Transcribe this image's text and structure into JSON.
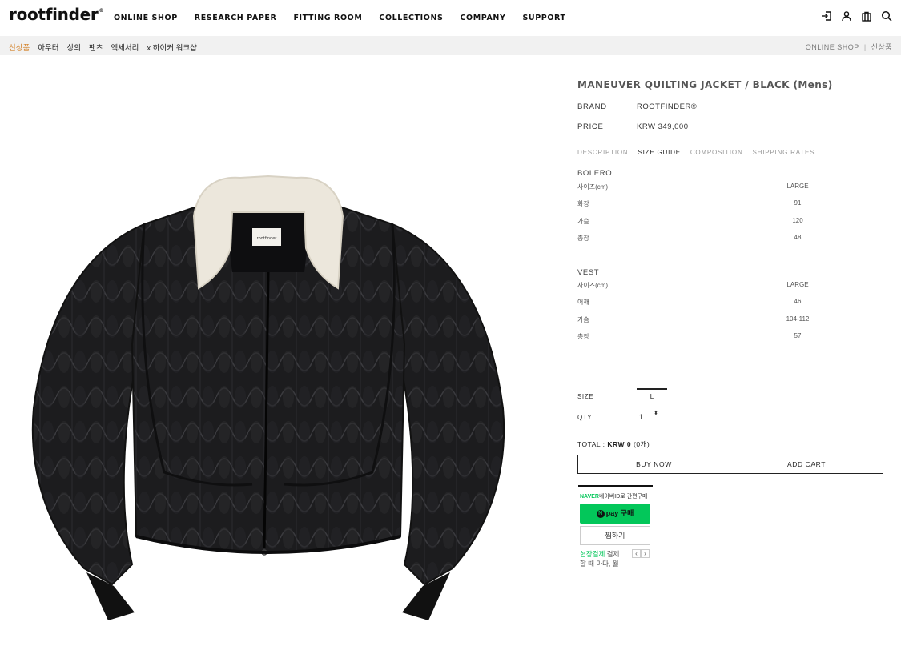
{
  "header": {
    "logo": "rootfinder",
    "logo_mark": "®",
    "nav": [
      "ONLINE SHOP",
      "RESEARCH PAPER",
      "FITTING ROOM",
      "COLLECTIONS",
      "COMPANY",
      "SUPPORT"
    ],
    "icons": [
      "login-icon",
      "user-icon",
      "shopping-bag-icon",
      "search-icon"
    ]
  },
  "subnav": {
    "categories": [
      "신상품",
      "아우터",
      "상의",
      "팬츠",
      "액세서리",
      "x 하이커 워크샵"
    ],
    "breadcrumb": [
      "ONLINE SHOP",
      "신상품"
    ],
    "breadcrumb_sep": "|"
  },
  "product": {
    "image_label": "rootfinder",
    "title": "MANEUVER QUILTING JACKET / BLACK (Mens)",
    "brand_label": "BRAND",
    "brand": "ROOTFINDER®",
    "price_label": "PRICE",
    "price": "KRW 349,000"
  },
  "tabs": [
    "DESCRIPTION",
    "SIZE GUIDE",
    "COMPOSITION",
    "SHIPPING RATES"
  ],
  "size_guide": {
    "bolero": {
      "title": "BOLERO",
      "rows": [
        {
          "k": "사이즈(cm)",
          "v": "LARGE"
        },
        {
          "k": "화장",
          "v": "91"
        },
        {
          "k": "가슴",
          "v": "120"
        },
        {
          "k": "총장",
          "v": "48"
        }
      ]
    },
    "vest": {
      "title": "VEST",
      "rows": [
        {
          "k": "사이즈(cm)",
          "v": "LARGE"
        },
        {
          "k": "어깨",
          "v": "46"
        },
        {
          "k": "가슴",
          "v": "104-112"
        },
        {
          "k": "총장",
          "v": "57"
        }
      ]
    }
  },
  "options": {
    "size_label": "SIZE",
    "size_value": "L",
    "qty_label": "QTY",
    "qty_value": "1",
    "qty_stepper": "⬍"
  },
  "total": {
    "label": "TOTAL :",
    "amount": "KRW 0",
    "count": "(0개)"
  },
  "buttons": {
    "buy_now": "BUY NOW",
    "add_cart": "ADD CART"
  },
  "naver": {
    "brand": "NAVER",
    "tagline": "네이버ID로 간편구매",
    "n_mark": "N",
    "pay_label": "pay 구매",
    "wish_label": "찜하기",
    "note_highlight": "현장결제",
    "note_rest": " 결제",
    "note_line2": "할 때 마다, 월",
    "prev": "‹",
    "next": "›"
  },
  "colors": {
    "accent_orange": "#d4832b",
    "naver_green": "#03c75a",
    "subnav_bg": "#f1f1f1"
  }
}
